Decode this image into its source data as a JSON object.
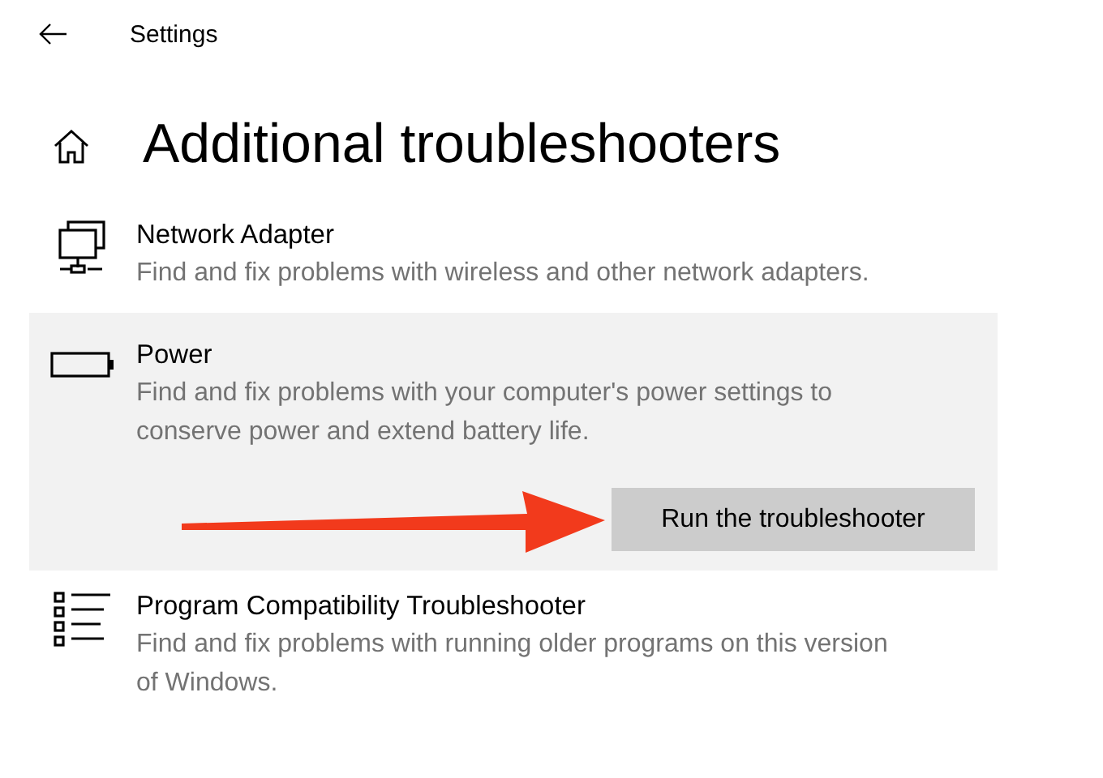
{
  "header": {
    "title": "Settings"
  },
  "page_title": "Additional troubleshooters",
  "items": [
    {
      "kind": "network",
      "title": "Network Adapter",
      "description": "Find and fix problems with wireless and other network adapters.",
      "expanded": false
    },
    {
      "kind": "battery",
      "title": "Power",
      "description": "Find and fix problems with your computer's power settings to conserve power and extend battery life.",
      "expanded": true,
      "button": "Run the troubleshooter"
    },
    {
      "kind": "list",
      "title": "Program Compatibility Troubleshooter",
      "description": "Find and fix problems with running older programs on this version of Windows.",
      "expanded": false
    }
  ]
}
